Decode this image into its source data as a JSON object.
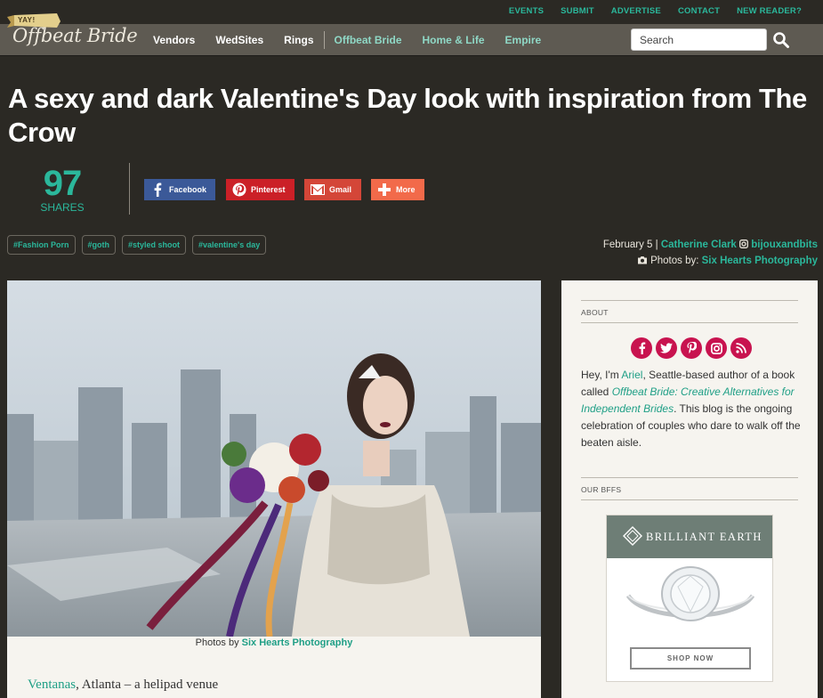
{
  "top_links": [
    "EVENTS",
    "SUBMIT",
    "ADVERTISE",
    "CONTACT",
    "NEW READER?"
  ],
  "logo": {
    "ribbon": "YAY!",
    "wordmark": "Offbeat Bride"
  },
  "nav": {
    "primary": [
      "Vendors",
      "WedSites",
      "Rings"
    ],
    "secondary": [
      "Offbeat Bride",
      "Home & Life",
      "Empire"
    ]
  },
  "search": {
    "placeholder": "Search"
  },
  "article": {
    "title": "A sexy and dark Valentine's Day look with inspiration from The Crow",
    "share_count": "97",
    "share_label": "SHARES",
    "share_buttons": {
      "facebook": "Facebook",
      "pinterest": "Pinterest",
      "gmail": "Gmail",
      "more": "More"
    },
    "tags": [
      "#Fashion Porn",
      "#goth",
      "#styled shoot",
      "#valentine's day"
    ],
    "date": "February 5",
    "author": "Catherine Clark",
    "instagram": "bijouxandbits",
    "photos_label": "Photos by:",
    "photographer": "Six Hearts Photography",
    "caption_prefix": "Photos by",
    "caption_credit": "Six Hearts Photography",
    "venue_link": "Ventanas",
    "venue_text": ", Atlanta – a helipad venue"
  },
  "sidebar": {
    "about_label": "ABOUT",
    "about": {
      "hey": "Hey, I'm ",
      "name": "Ariel",
      "mid": ", Seattle-based author of a book called ",
      "book": "Offbeat Bride: Creative Alternatives for Independent Brides",
      "end": ". This blog is the ongoing celebration of couples who dare to walk off the beaten aisle."
    },
    "bffs_label": "OUR BFFS",
    "ad": {
      "brand": "BRILLIANT EARTH",
      "cta": "SHOP NOW"
    }
  },
  "colors": {
    "teal": "#2bb79b",
    "facebook": "#3b5998",
    "pinterest": "#cb2027",
    "gmail": "#d44638",
    "more": "#f26a4a",
    "social_pink": "#c8134f"
  }
}
